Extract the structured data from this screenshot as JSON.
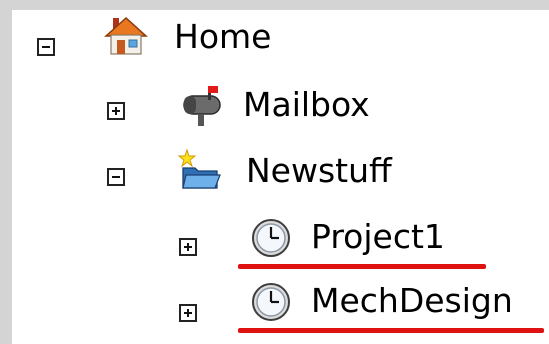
{
  "tree": {
    "nodes": [
      {
        "label": "Home",
        "toggle": "collapse",
        "icon": "house-icon"
      },
      {
        "label": "Mailbox",
        "toggle": "expand",
        "icon": "mailbox-icon"
      },
      {
        "label": "Newstuff",
        "toggle": "collapse",
        "icon": "new-folder-icon"
      },
      {
        "label": "Project1",
        "toggle": "expand",
        "icon": "clock-icon",
        "highlight": true
      },
      {
        "label": "MechDesign",
        "toggle": "expand",
        "icon": "clock-icon",
        "highlight": true
      }
    ],
    "highlight_color": "#e01111"
  }
}
